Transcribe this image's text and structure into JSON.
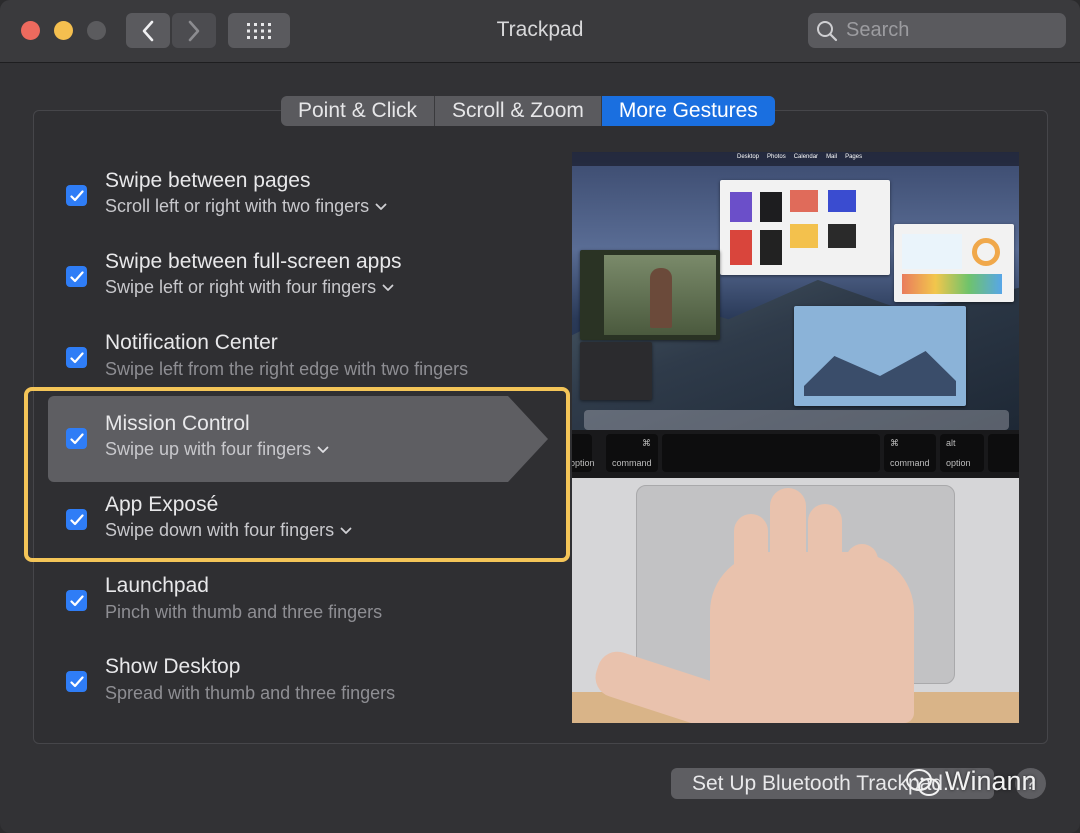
{
  "window": {
    "title": "Trackpad",
    "search_placeholder": "Search"
  },
  "tabs": [
    {
      "label": "Point & Click",
      "active": false
    },
    {
      "label": "Scroll & Zoom",
      "active": false
    },
    {
      "label": "More Gestures",
      "active": true
    }
  ],
  "gestures": [
    {
      "title": "Swipe between pages",
      "subtitle": "Scroll left or right with two fingers",
      "checked": true,
      "has_menu": true
    },
    {
      "title": "Swipe between full-screen apps",
      "subtitle": "Swipe left or right with four fingers",
      "checked": true,
      "has_menu": true
    },
    {
      "title": "Notification Center",
      "subtitle": "Swipe left from the right edge with two fingers",
      "checked": true,
      "has_menu": false
    },
    {
      "title": "Mission Control",
      "subtitle": "Swipe up with four fingers",
      "checked": true,
      "has_menu": true,
      "selected": true
    },
    {
      "title": "App Exposé",
      "subtitle": "Swipe down with four fingers",
      "checked": true,
      "has_menu": true
    },
    {
      "title": "Launchpad",
      "subtitle": "Pinch with thumb and three fingers",
      "checked": true,
      "has_menu": false
    },
    {
      "title": "Show Desktop",
      "subtitle": "Spread with thumb and three fingers",
      "checked": true,
      "has_menu": false
    }
  ],
  "preview": {
    "keys": [
      "option",
      "command",
      "command",
      "option"
    ],
    "keys_top": [
      "alt",
      "⌘",
      "⌘",
      "alt"
    ],
    "menubar_items": [
      "Desktop",
      "Photos",
      "Calendar",
      "Mail",
      "Pages"
    ]
  },
  "footer": {
    "setup_button": "Set Up Bluetooth Trackpad...",
    "help_button": "?"
  },
  "watermark": "Winann",
  "colors": {
    "accent": "#1a6fe0",
    "checkbox": "#2f7df6",
    "highlight": "#f4c558"
  }
}
